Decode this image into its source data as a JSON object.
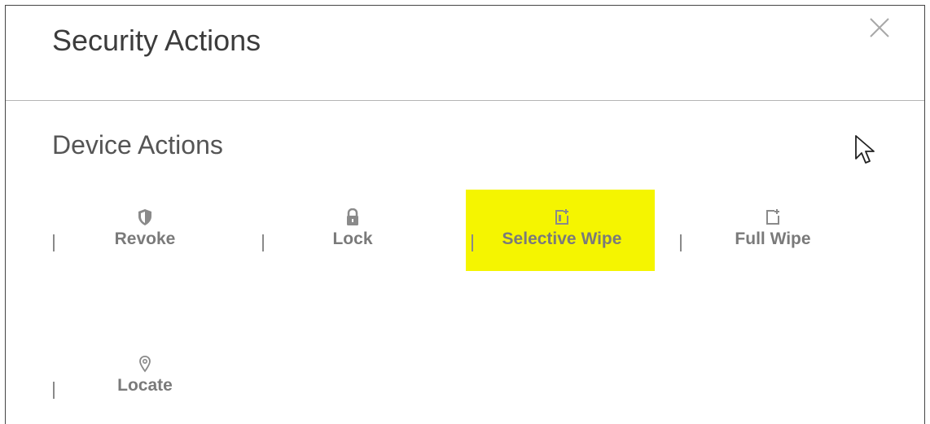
{
  "dialog": {
    "title": "Security Actions",
    "close_icon": "close-icon"
  },
  "section": {
    "title": "Device Actions"
  },
  "actions": [
    {
      "label": "Revoke",
      "icon": "shield-icon"
    },
    {
      "label": "Lock",
      "icon": "lock-icon"
    },
    {
      "label": "Selective Wipe",
      "icon": "selective-wipe-icon",
      "highlighted": true,
      "highlight_color": "#f5f500"
    },
    {
      "label": "Full Wipe",
      "icon": "full-wipe-icon"
    },
    {
      "label": "Locate",
      "icon": "location-pin-icon"
    }
  ],
  "colors": {
    "label": "#7a7a7a",
    "title": "#3c3c3c",
    "divider": "#b5b5b5"
  }
}
